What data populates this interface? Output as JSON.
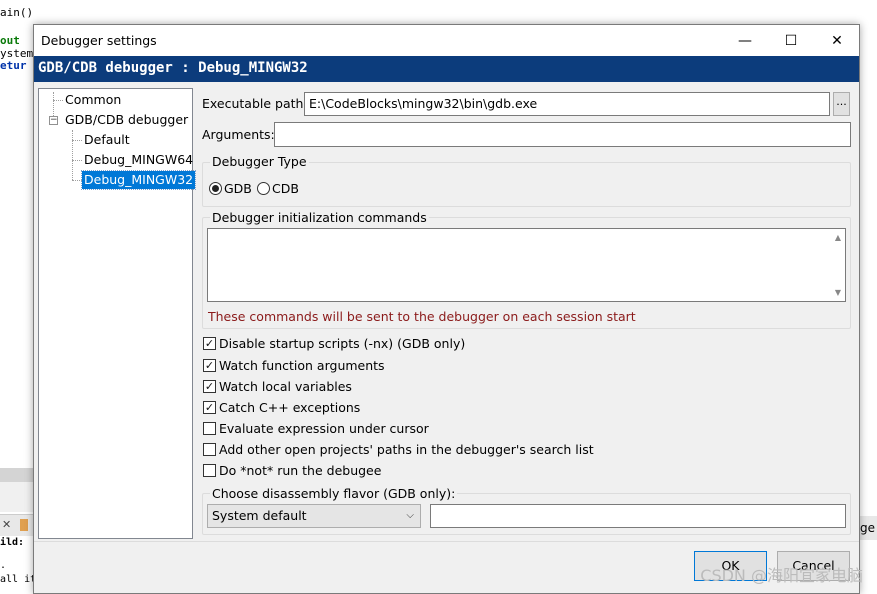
{
  "background_editor": {
    "code_lines": [
      "ain()",
      "out ",
      "ystem",
      "etur"
    ],
    "log_lines": [
      "ild:",
      ".",
      "all items are up-to-date."
    ],
    "tab_fragment": "ge"
  },
  "dialog": {
    "title": "Debugger settings",
    "window_buttons": {
      "minimize": "—",
      "maximize": "☐",
      "close": "✕"
    },
    "header": "GDB/CDB debugger : Debug_MINGW32",
    "tree": {
      "items": [
        {
          "label": "Common",
          "level": 0
        },
        {
          "label": "GDB/CDB debugger",
          "level": 0,
          "expander": "−"
        },
        {
          "label": "Default",
          "level": 1
        },
        {
          "label": "Debug_MINGW64",
          "level": 1
        },
        {
          "label": "Debug_MINGW32",
          "level": 1,
          "selected": true
        }
      ]
    },
    "executable_path": {
      "label": "Executable path:",
      "value": "E:\\CodeBlocks\\mingw32\\bin\\gdb.exe",
      "browse_label": "..."
    },
    "arguments": {
      "label": "Arguments:",
      "value": ""
    },
    "debugger_type": {
      "title": "Debugger Type",
      "options": [
        {
          "label": "GDB",
          "selected": true
        },
        {
          "label": "CDB",
          "selected": false
        }
      ]
    },
    "init_commands": {
      "title": "Debugger initialization commands",
      "value": "",
      "hint": "These commands will be sent to the debugger on each session start"
    },
    "checkboxes": [
      {
        "label": "Disable startup scripts (-nx) (GDB only)",
        "checked": true
      },
      {
        "label": "Watch function arguments",
        "checked": true
      },
      {
        "label": "Watch local variables",
        "checked": true
      },
      {
        "label": "Catch C++ exceptions",
        "checked": true
      },
      {
        "label": "Evaluate expression under cursor",
        "checked": false
      },
      {
        "label": "Add other open projects' paths in the debugger's search list",
        "checked": false
      },
      {
        "label": "Do *not* run the debugee",
        "checked": false
      }
    ],
    "disassembly": {
      "title": "Choose disassembly flavor (GDB only):",
      "selected": "System default",
      "extra": ""
    },
    "buttons": {
      "ok": "OK",
      "cancel": "Cancel"
    }
  },
  "watermark": "CSDN @海阳宜家电脑",
  "colors": {
    "header": "#0c3c7c",
    "selection": "#0078d7",
    "hint": "#8b1a1a"
  }
}
